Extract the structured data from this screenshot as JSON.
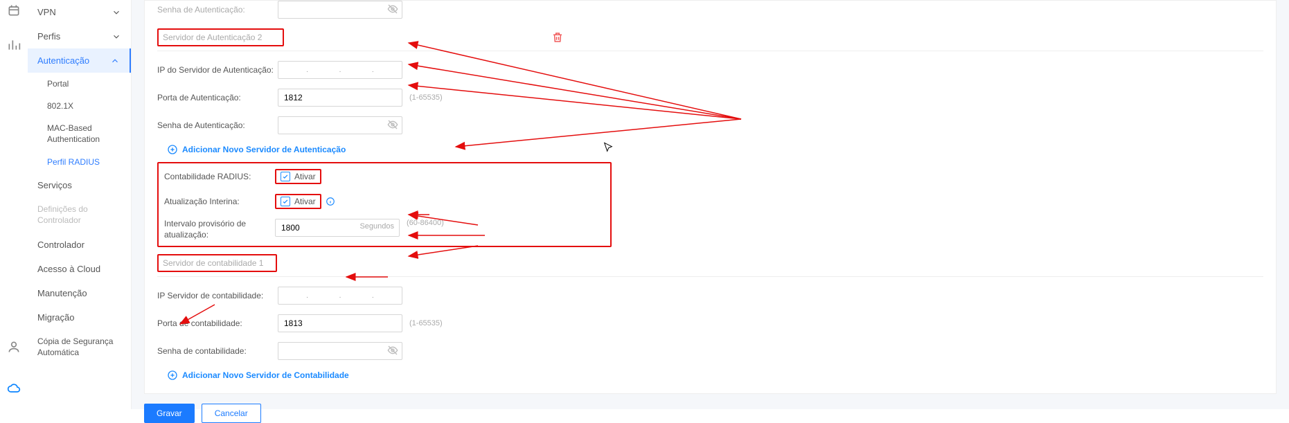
{
  "nav": {
    "vpn": "VPN",
    "perfis": "Perfis",
    "auth": "Autenticação",
    "sub": {
      "portal": "Portal",
      "dot1x": "802.1X",
      "mac": "MAC-Based Authentication",
      "radius": "Perfil RADIUS"
    },
    "servicos": "Serviços",
    "defctrl": "Definições do Controlador",
    "controlador": "Controlador",
    "cloud": "Acesso à Cloud",
    "manut": "Manutenção",
    "migra": "Migração",
    "backup": "Cópia de Segurança Automática"
  },
  "form": {
    "authpw_top": "Senha de Autenticação:",
    "server2_title": "Servidor de Autenticação 2",
    "auth_ip": "IP do Servidor de Autenticação:",
    "auth_port": "Porta de Autenticação:",
    "auth_port_val": "1812",
    "port_hint": "(1-65535)",
    "auth_pw": "Senha de Autenticação:",
    "add_auth": "Adicionar Novo Servidor de Autenticação",
    "radius_acct": "Contabilidade RADIUS:",
    "ativar": "Ativar",
    "interim": "Atualização Interina:",
    "interval_lbl": "Intervalo provisório de atualização:",
    "interval_val": "1800",
    "interval_unit": "Segundos",
    "interval_hint": "(60-86400)",
    "acct1_title": "Servidor de contabilidade 1",
    "acct_ip": "IP Servidor de contabilidade:",
    "acct_port": "Porta de contabilidade:",
    "acct_port_val": "1813",
    "acct_pw": "Senha de contabilidade:",
    "add_acct": "Adicionar Novo Servidor de Contabilidade",
    "save": "Gravar",
    "cancel": "Cancelar"
  }
}
